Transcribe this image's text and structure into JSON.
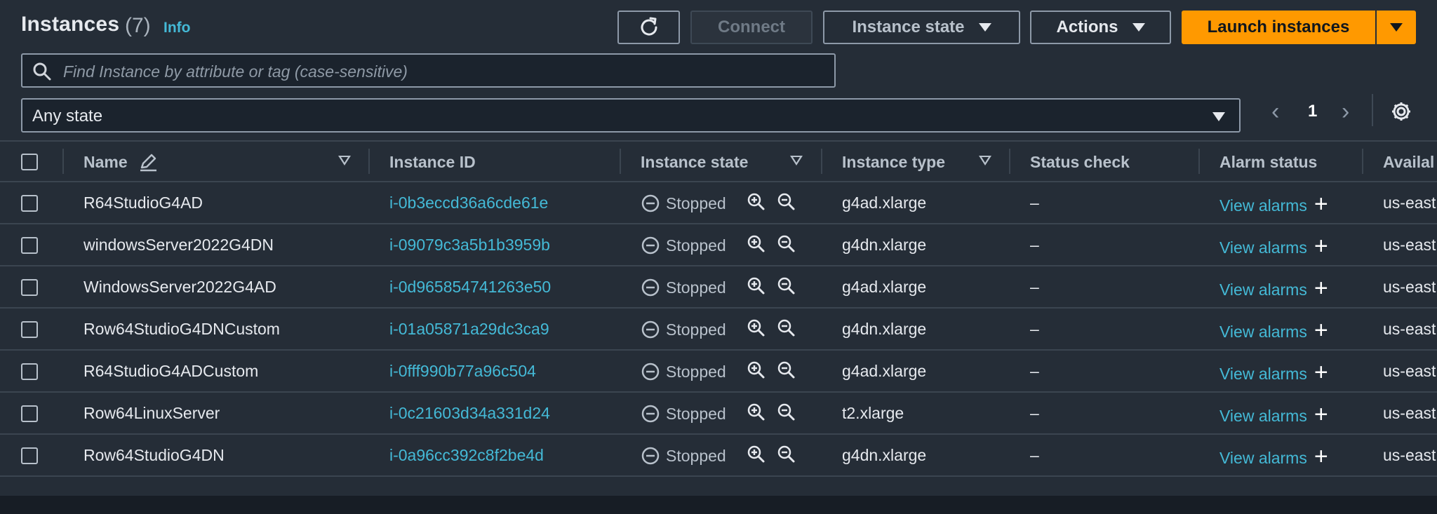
{
  "header": {
    "title": "Instances",
    "count": "(7)",
    "info": "Info"
  },
  "toolbar": {
    "connect": "Connect",
    "instance_state": "Instance state",
    "actions": "Actions",
    "launch": "Launch instances"
  },
  "search": {
    "placeholder": "Find Instance by attribute or tag (case-sensitive)",
    "value": ""
  },
  "filter": {
    "selected": "Any state"
  },
  "pagination": {
    "prev": "‹",
    "page": "1",
    "next": "›"
  },
  "table": {
    "columns": {
      "name": "Name",
      "instance_id": "Instance ID",
      "instance_state": "Instance state",
      "instance_type": "Instance type",
      "status_check": "Status check",
      "alarm_status": "Alarm status",
      "availability": "Availal"
    },
    "rows": [
      {
        "name": "R64StudioG4AD",
        "id": "i-0b3eccd36a6cde61e",
        "state": "Stopped",
        "type": "g4ad.xlarge",
        "status": "–",
        "alarm": "View alarms",
        "az": "us-east"
      },
      {
        "name": "windowsServer2022G4DN",
        "id": "i-09079c3a5b1b3959b",
        "state": "Stopped",
        "type": "g4dn.xlarge",
        "status": "–",
        "alarm": "View alarms",
        "az": "us-east"
      },
      {
        "name": "WindowsServer2022G4AD",
        "id": "i-0d965854741263e50",
        "state": "Stopped",
        "type": "g4ad.xlarge",
        "status": "–",
        "alarm": "View alarms",
        "az": "us-east"
      },
      {
        "name": "Row64StudioG4DNCustom",
        "id": "i-01a05871a29dc3ca9",
        "state": "Stopped",
        "type": "g4dn.xlarge",
        "status": "–",
        "alarm": "View alarms",
        "az": "us-east"
      },
      {
        "name": "R64StudioG4ADCustom",
        "id": "i-0fff990b77a96c504",
        "state": "Stopped",
        "type": "g4ad.xlarge",
        "status": "–",
        "alarm": "View alarms",
        "az": "us-east"
      },
      {
        "name": "Row64LinuxServer",
        "id": "i-0c21603d34a331d24",
        "state": "Stopped",
        "type": "t2.xlarge",
        "status": "–",
        "alarm": "View alarms",
        "az": "us-east"
      },
      {
        "name": "Row64StudioG4DN",
        "id": "i-0a96cc392c8f2be4d",
        "state": "Stopped",
        "type": "g4dn.xlarge",
        "status": "–",
        "alarm": "View alarms",
        "az": "us-east"
      }
    ]
  },
  "colors": {
    "accent_orange": "#ff9900",
    "link_blue": "#44b9d6",
    "background": "#252d37"
  },
  "icons": [
    "refresh-icon",
    "search-icon",
    "settings-gear-icon",
    "stopped-icon",
    "zoom-in-icon",
    "zoom-out-icon",
    "add-alarm-icon",
    "edit-icon"
  ]
}
